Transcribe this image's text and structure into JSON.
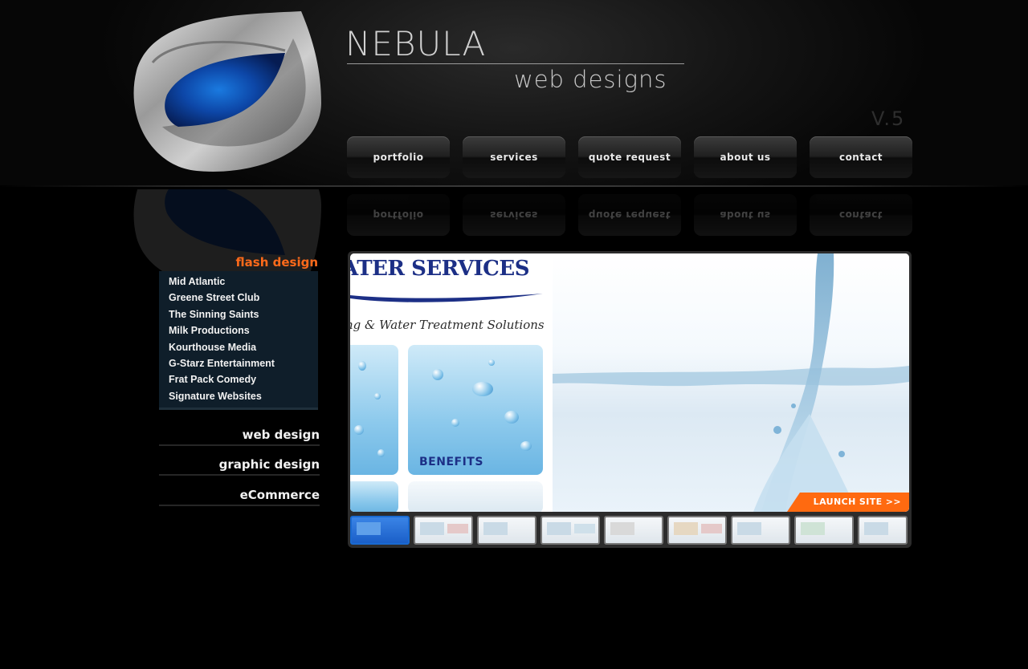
{
  "brand": {
    "title": "NEBULA",
    "subtitle": "web designs",
    "version": "V.5"
  },
  "nav": {
    "items": [
      {
        "label": "portfolio"
      },
      {
        "label": "services"
      },
      {
        "label": "quote request"
      },
      {
        "label": "about us"
      },
      {
        "label": "contact"
      }
    ]
  },
  "sidebar": {
    "active_category": "flash design",
    "flash_items": [
      {
        "label": "Mid Atlantic"
      },
      {
        "label": "Greene Street Club"
      },
      {
        "label": "The Sinning Saints"
      },
      {
        "label": "Milk Productions"
      },
      {
        "label": "Kourthouse Media"
      },
      {
        "label": "G-Starz Entertainment"
      },
      {
        "label": "Frat Pack Comedy"
      },
      {
        "label": "Signature Websites"
      }
    ],
    "categories": [
      {
        "label": "web design"
      },
      {
        "label": "graphic design"
      },
      {
        "label": "eCommerce"
      }
    ]
  },
  "viewer": {
    "shot_title": "ATER SERVICES",
    "shot_tagline": "ng & Water Treatment Solutions",
    "shot_benefits": "BENEFITS",
    "launch_label": "LAUNCH SITE >>"
  },
  "colors": {
    "accent_orange": "#ff6a10",
    "panel_navy": "#0f1e2a"
  }
}
